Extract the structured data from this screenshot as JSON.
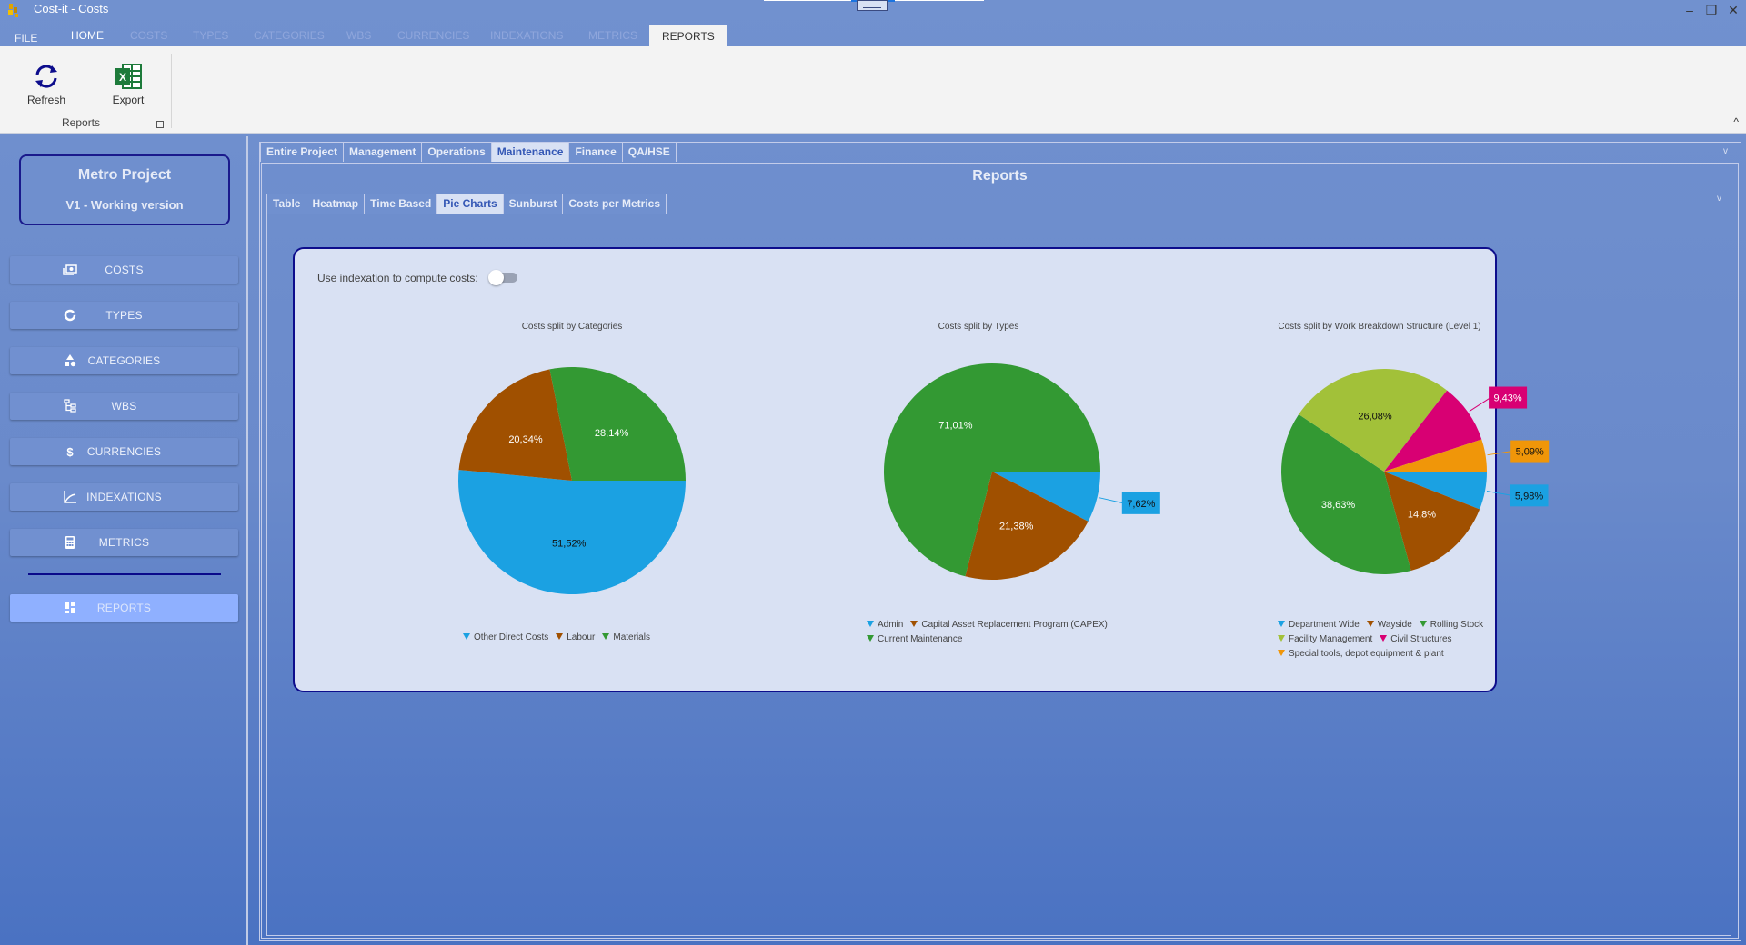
{
  "window": {
    "title": "Cost-it - Costs",
    "controls": {
      "minimize": "–",
      "restore": "❐",
      "close": "✕"
    }
  },
  "ribbon": {
    "tabs": [
      {
        "label": "FILE",
        "state": "normal"
      },
      {
        "label": "HOME",
        "state": "normal"
      },
      {
        "label": "COSTS",
        "state": "disabled"
      },
      {
        "label": "TYPES",
        "state": "disabled"
      },
      {
        "label": "CATEGORIES",
        "state": "disabled"
      },
      {
        "label": "WBS",
        "state": "disabled"
      },
      {
        "label": "CURRENCIES",
        "state": "disabled"
      },
      {
        "label": "INDEXATIONS",
        "state": "disabled"
      },
      {
        "label": "METRICS",
        "state": "disabled"
      },
      {
        "label": "REPORTS",
        "state": "active"
      }
    ],
    "buttons": [
      {
        "label": "Refresh",
        "icon": "refresh-icon"
      },
      {
        "label": "Export",
        "icon": "excel-icon"
      }
    ],
    "group_label": "Reports"
  },
  "sidebar": {
    "project_name": "Metro Project",
    "project_version": "V1 - Working version",
    "items": [
      {
        "label": "COSTS",
        "icon": "money-icon"
      },
      {
        "label": "TYPES",
        "icon": "donut-icon"
      },
      {
        "label": "CATEGORIES",
        "icon": "shapes-icon"
      },
      {
        "label": "WBS",
        "icon": "tree-icon"
      },
      {
        "label": "CURRENCIES",
        "icon": "dollar-icon"
      },
      {
        "label": "INDEXATIONS",
        "icon": "chart-line-icon"
      },
      {
        "label": "METRICS",
        "icon": "calculator-icon"
      },
      {
        "label": "REPORTS",
        "icon": "dashboard-icon",
        "active": true
      }
    ]
  },
  "main": {
    "department_tabs": [
      "Entire Project",
      "Management",
      "Operations",
      "Maintenance",
      "Finance",
      "QA/HSE"
    ],
    "active_department": "Maintenance",
    "reports_title": "Reports",
    "report_tabs": [
      "Table",
      "Heatmap",
      "Time Based",
      "Pie Charts",
      "Sunburst",
      "Costs per Metrics"
    ],
    "active_report_tab": "Pie Charts",
    "toggle": {
      "label": "Use indexation to compute costs:",
      "checked": false
    }
  },
  "chart_data": [
    {
      "type": "pie",
      "title": "Costs split by Categories",
      "categories": [
        "Other Direct Costs",
        "Labour",
        "Materials"
      ],
      "values": [
        51.52,
        20.34,
        28.14
      ],
      "labels": [
        "51,52%",
        "20,34%",
        "28,14%"
      ],
      "colors": [
        "#1ba1e2",
        "#a05000",
        "#339933"
      ],
      "legend": "bottom"
    },
    {
      "type": "pie",
      "title": "Costs split by Types",
      "categories": [
        "Admin",
        "Capital Asset Replacement Program (CAPEX)",
        "Current Maintenance"
      ],
      "values": [
        7.62,
        21.38,
        71.01
      ],
      "labels": [
        "7,62%",
        "21,38%",
        "71,01%"
      ],
      "colors": [
        "#1ba1e2",
        "#a05000",
        "#339933"
      ],
      "legend": "bottom"
    },
    {
      "type": "pie",
      "title": "Costs split by Work Breakdown Structure (Level 1)",
      "categories": [
        "Department Wide",
        "Wayside",
        "Rolling Stock",
        "Facility Management",
        "Civil Structures",
        "Special tools, depot equipment & plant"
      ],
      "values": [
        5.98,
        14.8,
        38.63,
        26.08,
        9.43,
        5.09
      ],
      "labels": [
        "5,98%",
        "14,8%",
        "38,63%",
        "26,08%",
        "9,43%",
        "5,09%"
      ],
      "colors": [
        "#1ba1e2",
        "#a05000",
        "#339933",
        "#a2c139",
        "#d80073",
        "#f09609"
      ],
      "legend": "bottom"
    }
  ]
}
